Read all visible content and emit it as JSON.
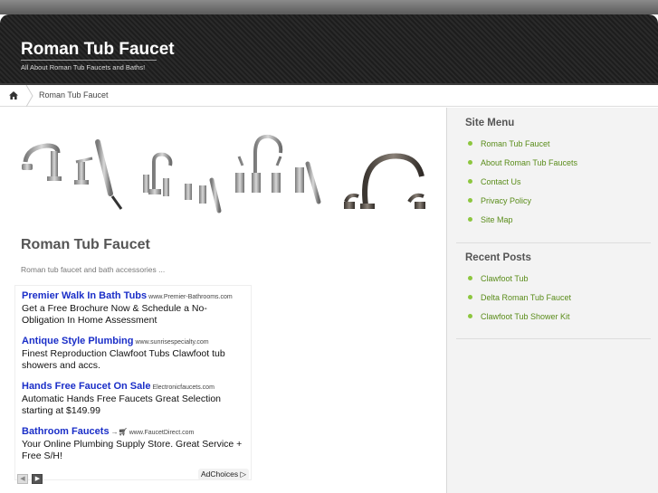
{
  "header": {
    "title": "Roman Tub Faucet",
    "tagline": "All About Roman Tub Faucets and Baths!"
  },
  "breadcrumb": {
    "home_icon": "home-icon",
    "current": "Roman Tub Faucet"
  },
  "post": {
    "title": "Roman Tub Faucet",
    "excerpt": "Roman tub faucet and bath accessories ..."
  },
  "ads": [
    {
      "title": "Premier Walk In Bath Tubs",
      "url": "www.Premier-Bathrooms.com",
      "body": "Get a Free Brochure Now & Schedule a No-Obligation In Home Assessment"
    },
    {
      "title": "Antique Style Plumbing",
      "url": "www.sunrisespecialty.com",
      "body": "Finest Reproduction Clawfoot Tubs Clawfoot tub showers and accs."
    },
    {
      "title": "Hands Free Faucet On Sale",
      "url": "Electronicfaucets.com",
      "body": "Automatic Hands Free Faucets Great Selection starting at $149.99"
    },
    {
      "title": "Bathroom Faucets",
      "url": "www.FaucetDirect.com",
      "body": "Your Online Plumbing Supply Store. Great Service + Free S/H!"
    }
  ],
  "ad_controls": {
    "prev_icon": "chevron-left-icon",
    "next_icon": "chevron-right-icon",
    "adchoices": "AdChoices"
  },
  "sidebar": {
    "site_menu_title": "Site Menu",
    "site_menu": [
      "Roman Tub Faucet",
      "About Roman Tub Faucets",
      "Contact Us",
      "Privacy Policy",
      "Site Map"
    ],
    "recent_title": "Recent Posts",
    "recent": [
      "Clawfoot Tub",
      "Delta Roman Tub Faucet",
      "Clawfoot Tub Shower Kit"
    ]
  },
  "colors": {
    "header_bg": "#222222",
    "link_green": "#5a8c1a",
    "bullet_green": "#8dc63f",
    "ad_title_blue": "#1a2ec8"
  }
}
